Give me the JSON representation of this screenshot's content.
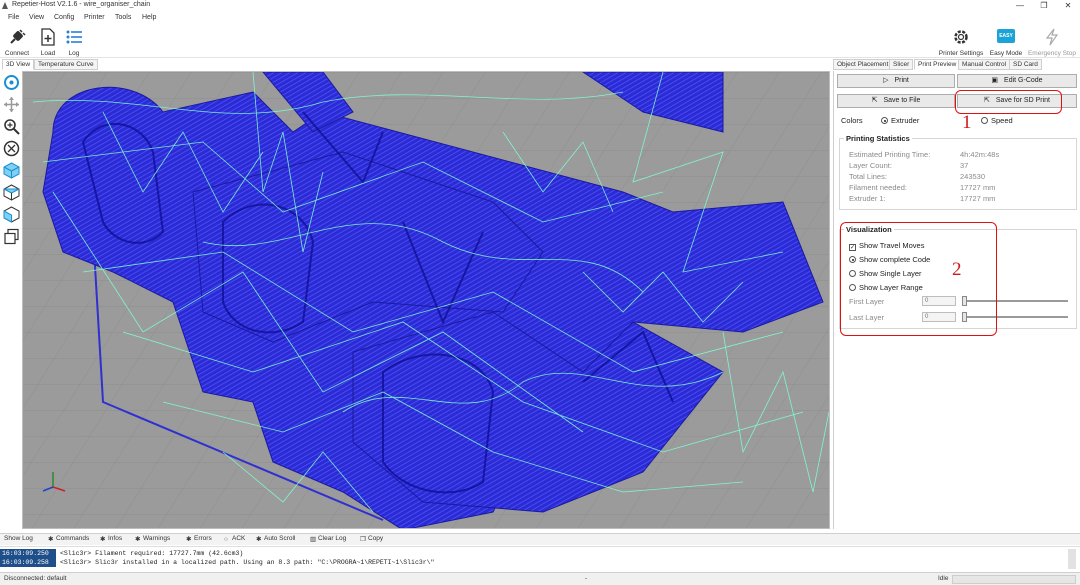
{
  "window": {
    "title": "Repetier-Host V2.1.6 - wire_organiser_chain",
    "minimize_glyph": "—",
    "restore_glyph": "❐",
    "close_glyph": "✕"
  },
  "menu": [
    "File",
    "View",
    "Config",
    "Printer",
    "Tools",
    "Help"
  ],
  "toolbar": {
    "connect": "Connect",
    "load": "Load",
    "log": "Log",
    "printer_settings": "Printer Settings",
    "easy_mode": "Easy Mode",
    "easy_badge": "EASY",
    "emergency_stop": "Emergency Stop"
  },
  "left_tabs": [
    "3D View",
    "Temperature Curve"
  ],
  "right_tabs": [
    "Object Placement",
    "Slicer",
    "Print Preview",
    "Manual Control",
    "SD Card"
  ],
  "panel": {
    "print_button": "Print",
    "edit_gcode_button": "Edit G-Code",
    "save_to_file_button": "Save to File",
    "save_for_sd_button": "Save for SD Print",
    "colors_label": "Colors",
    "color_options": [
      "Extruder",
      "Speed"
    ],
    "stats": {
      "title": "Printing Statistics",
      "rows": [
        {
          "label": "Estimated Printing Time:",
          "value": "4h:42m:48s"
        },
        {
          "label": "Layer Count:",
          "value": "37"
        },
        {
          "label": "Total Lines:",
          "value": "243530"
        },
        {
          "label": "Filament needed:",
          "value": "17727 mm"
        },
        {
          "label": "Extruder 1:",
          "value": "17727 mm"
        }
      ]
    },
    "visualization": {
      "title": "Visualization",
      "show_travel_moves": "Show Travel Moves",
      "modes": [
        "Show complete Code",
        "Show Single Layer",
        "Show Layer Range"
      ],
      "first_layer_label": "First Layer",
      "last_layer_label": "Last Layer",
      "first_layer_value": "0",
      "last_layer_value": "0"
    }
  },
  "annotations": [
    "1",
    "2"
  ],
  "log_toolbar": [
    "Show Log",
    "Commands",
    "Infos",
    "Warnings",
    "Errors",
    "ACK",
    "Auto Scroll",
    "Clear Log",
    "Copy"
  ],
  "log_rows": [
    {
      "time": "16:03:09.250",
      "msg": "<Slic3r> Filament required: 17727.7mm (42.6cm3)"
    },
    {
      "time": "16:03:09.258",
      "msg": "<Slic3r> Slic3r installed in a localized path. Using an 8.3 path: \"C:\\PROGRA~1\\REPETI~1\\Slic3r\\\""
    }
  ],
  "status": {
    "left": "Disconnected: default",
    "middle": "-",
    "right": "Idle"
  },
  "colors": {
    "print_blue": "#2b2bd6",
    "travel_cyan": "#7fffd4",
    "annotation_red": "#e01010",
    "log_time_bg": "#1f4f8a",
    "easy_badge": "#1aa3d6"
  }
}
